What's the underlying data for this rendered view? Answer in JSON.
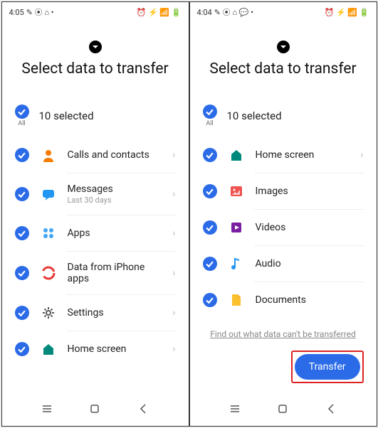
{
  "left": {
    "time": "4:05",
    "title": "Select data to transfer",
    "all_label": "All",
    "selected_text": "10 selected",
    "items": [
      {
        "label": "Calls and contacts",
        "sub": "",
        "icon": "contacts-icon",
        "arrow": true
      },
      {
        "label": "Messages",
        "sub": "Last 30 days",
        "icon": "messages-icon",
        "arrow": true
      },
      {
        "label": "Apps",
        "sub": "",
        "icon": "apps-icon",
        "arrow": true
      },
      {
        "label": "Data from iPhone apps",
        "sub": "",
        "icon": "iphone-data-icon",
        "arrow": true
      },
      {
        "label": "Settings",
        "sub": "",
        "icon": "settings-icon",
        "arrow": true
      },
      {
        "label": "Home screen",
        "sub": "",
        "icon": "home-icon",
        "arrow": true
      }
    ]
  },
  "right": {
    "time": "4:04",
    "title": "Select data to transfer",
    "all_label": "All",
    "selected_text": "10 selected",
    "items": [
      {
        "label": "Home screen",
        "sub": "",
        "icon": "home-icon",
        "arrow": true
      },
      {
        "label": "Images",
        "sub": "",
        "icon": "images-icon",
        "arrow": false
      },
      {
        "label": "Videos",
        "sub": "",
        "icon": "videos-icon",
        "arrow": false
      },
      {
        "label": "Audio",
        "sub": "",
        "icon": "audio-icon",
        "arrow": false
      },
      {
        "label": "Documents",
        "sub": "",
        "icon": "documents-icon",
        "arrow": false
      }
    ],
    "footer_link": "Find out what data can't be transferred",
    "transfer_label": "Transfer"
  }
}
